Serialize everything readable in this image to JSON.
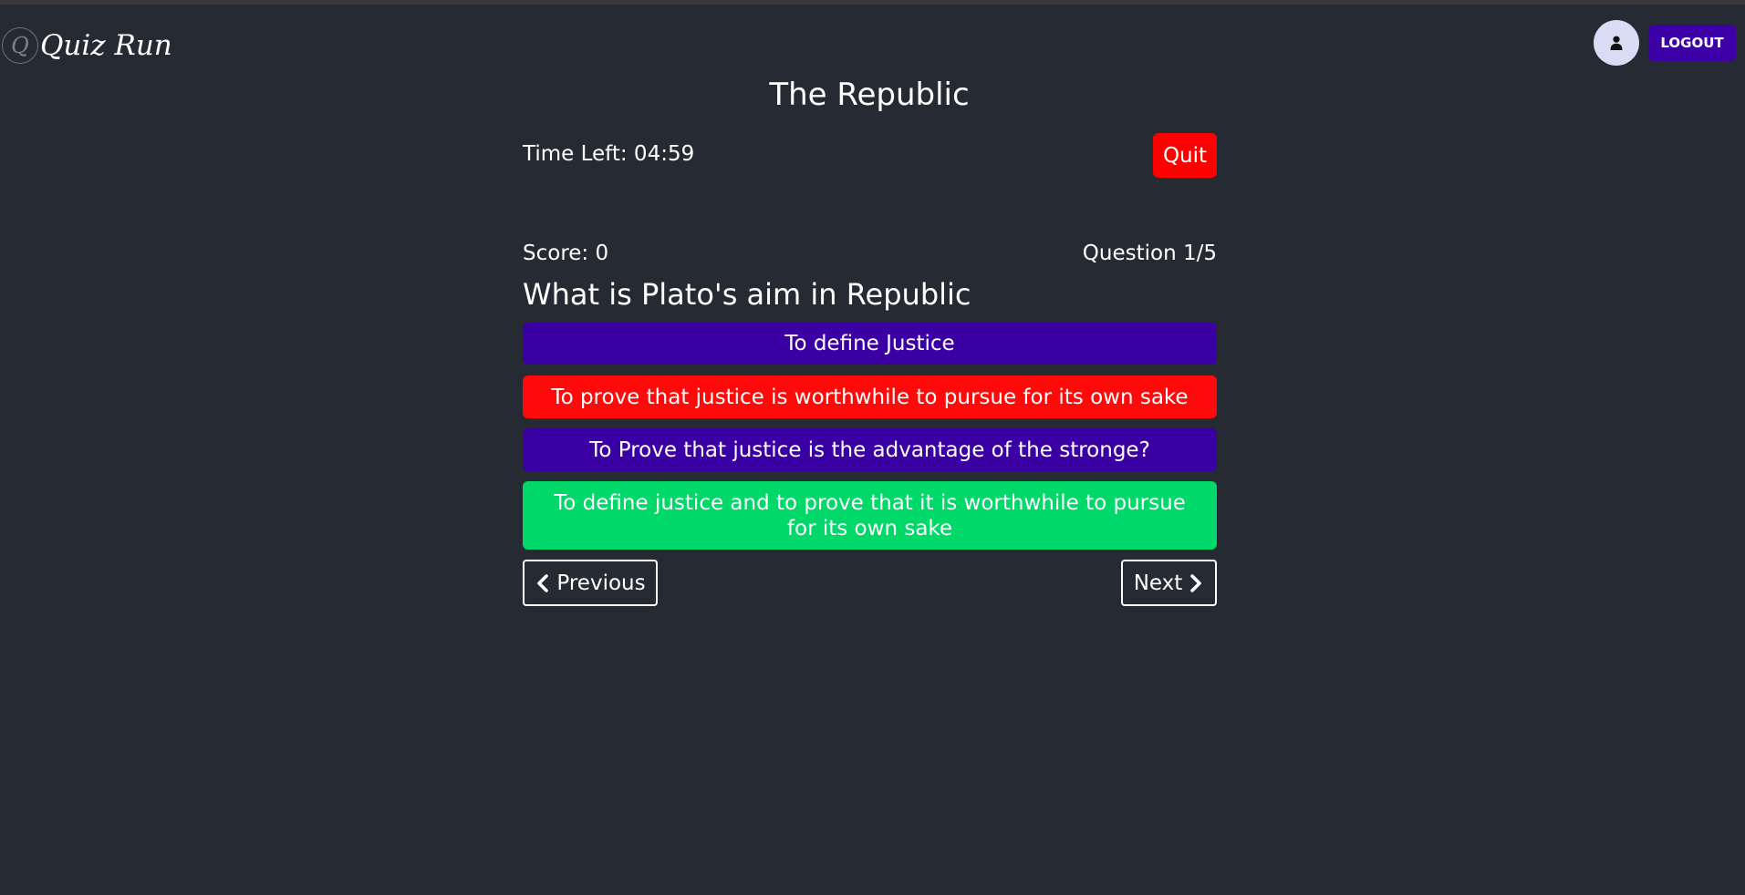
{
  "brand": {
    "logo_letter": "Q",
    "name": "Quiz Run"
  },
  "header": {
    "user_icon": "user-icon",
    "logout_label": "LOGOUT"
  },
  "quiz": {
    "title": "The Republic",
    "timer": "Time Left: 04:59",
    "quit_label": "Quit",
    "score": "Score: 0",
    "question_count": "Question 1/5",
    "question": "What is Plato's aim in Republic",
    "options": [
      {
        "label": "To define Justice",
        "color": "#3b00a3"
      },
      {
        "label": "To prove that justice is worthwhile to pursue for its own sake",
        "color": "#ff0a0a"
      },
      {
        "label": "To Prove that justice is the advantage of the stronge?",
        "color": "#3b00a3"
      },
      {
        "label": "To define justice and to prove that it is worthwhile to pursue for its own sake",
        "color": "#00d86a"
      }
    ],
    "prev_label": "Previous",
    "next_label": "Next",
    "prev_icon": "chevron-left-icon",
    "next_icon": "chevron-right-icon"
  },
  "colors": {
    "background": "#262b33",
    "accent": "#3d00a6",
    "danger": "#ff0000",
    "success": "#00d86a"
  }
}
